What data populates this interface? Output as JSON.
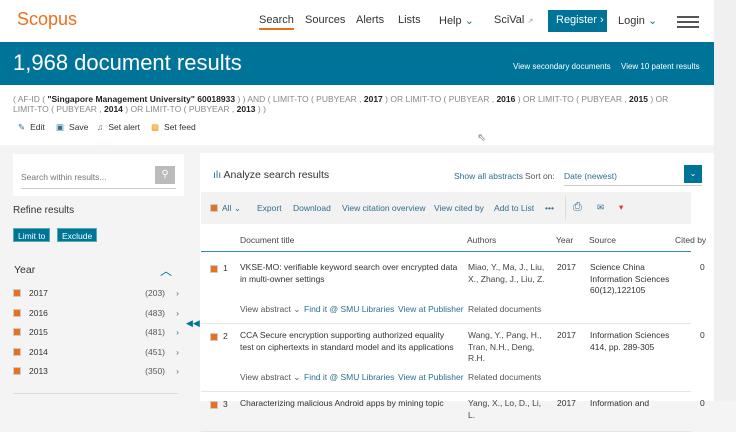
{
  "header": {
    "logo": "Scopus",
    "nav": [
      "Search",
      "Sources",
      "Alerts",
      "Lists",
      "Help",
      "SciVal"
    ],
    "register": "Register",
    "login": "Login"
  },
  "band": {
    "title": "1,968 document results",
    "secondary": "View secondary documents",
    "patent": "View 10 patent results"
  },
  "query": {
    "p1": "( AF-ID ( ",
    "org": "\"Singapore Management University\"  60018933",
    "p2": " ) )  AND  ( LIMIT-TO ( PUBYEAR , ",
    "y1": "2017",
    "p3": " )  OR  LIMIT-TO ( PUBYEAR , ",
    "y2": "2016",
    "p4": " )  OR  LIMIT-TO ( PUBYEAR , ",
    "y3": "2015",
    "p5": " )  OR  LIMIT-TO ( PUBYEAR , ",
    "y4": "2014",
    "p6": " )  OR  LIMIT-TO ( PUBYEAR , ",
    "y5": "2013",
    "p7": " ) )"
  },
  "actions": [
    "Edit",
    "Save",
    "Set alert",
    "Set feed"
  ],
  "sidebar": {
    "search_placeholder": "Search within results...",
    "refine": "Refine results",
    "limit": "Limit to",
    "exclude": "Exclude",
    "year_label": "Year",
    "years": [
      {
        "y": "2017",
        "c": "(203)"
      },
      {
        "y": "2016",
        "c": "(483)"
      },
      {
        "y": "2015",
        "c": "(481)"
      },
      {
        "y": "2014",
        "c": "(451)"
      },
      {
        "y": "2013",
        "c": "(350)"
      }
    ]
  },
  "main": {
    "analyze": "Analyze search results",
    "show_abstracts": "Show all abstracts",
    "sort_on": "Sort on:",
    "sort_value": "Date (newest)",
    "toolbar": {
      "all": "All",
      "export": "Export",
      "download": "Download",
      "citation": "View citation overview",
      "cited_by": "View cited by",
      "add_list": "Add to List",
      "more": "•••"
    },
    "columns": [
      "Document title",
      "Authors",
      "Year",
      "Source",
      "Cited by"
    ],
    "rows": [
      {
        "n": "1",
        "title": "VKSE-MO: verifiable keyword search over encrypted data in multi-owner settings",
        "authors": "Miao, Y., Ma, J., Liu, X., Zhang, J., Liu, Z.",
        "year": "2017",
        "source": "Science China Information Sciences 60(12),122105",
        "cited": "0"
      },
      {
        "n": "2",
        "title": "CCA Secure encryption supporting authorized equality test on ciphertexts in standard model and its applications",
        "authors": "Wang, Y., Pang, H., Tran, N.H., Deng, R.H.",
        "year": "2017",
        "source": "Information Sciences 414, pp. 289-305",
        "cited": "0"
      },
      {
        "n": "3",
        "title": "Characterizing malicious Android apps by mining topic",
        "authors": "Yang, X., Lo, D., Li, L.",
        "year": "2017",
        "source": "Information and",
        "cited": "0"
      }
    ],
    "row_links": {
      "abstract": "View abstract",
      "find": "Find it @ SMU Libraries",
      "publisher": "View at Publisher",
      "related": "Related documents"
    }
  }
}
